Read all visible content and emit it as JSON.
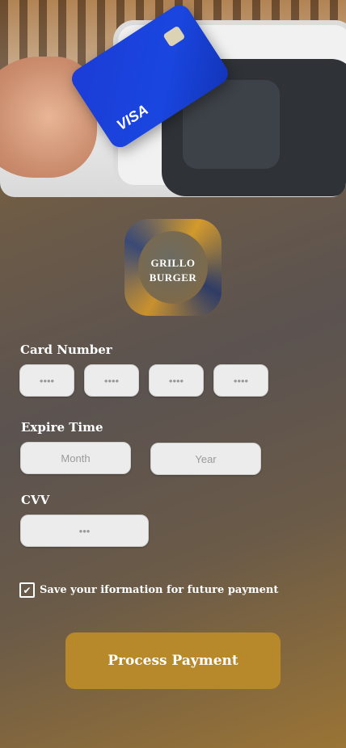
{
  "brand": {
    "logo_line1": "GRILLO",
    "logo_line2": "BURGER"
  },
  "hero": {
    "card_brand": "VISA"
  },
  "card_number": {
    "label": "Card Number",
    "fields": [
      "••••",
      "••••",
      "••••",
      "••••"
    ]
  },
  "expire": {
    "label": "Expire Time",
    "month_placeholder": "Month",
    "year_placeholder": "Year"
  },
  "cvv": {
    "label": "CVV",
    "placeholder": "•••"
  },
  "save_info": {
    "label": "Save your iformation for future payment",
    "checked": true,
    "check_glyph": "✔"
  },
  "actions": {
    "process_payment": "Process Payment"
  },
  "colors": {
    "accent": "#b8892a"
  }
}
